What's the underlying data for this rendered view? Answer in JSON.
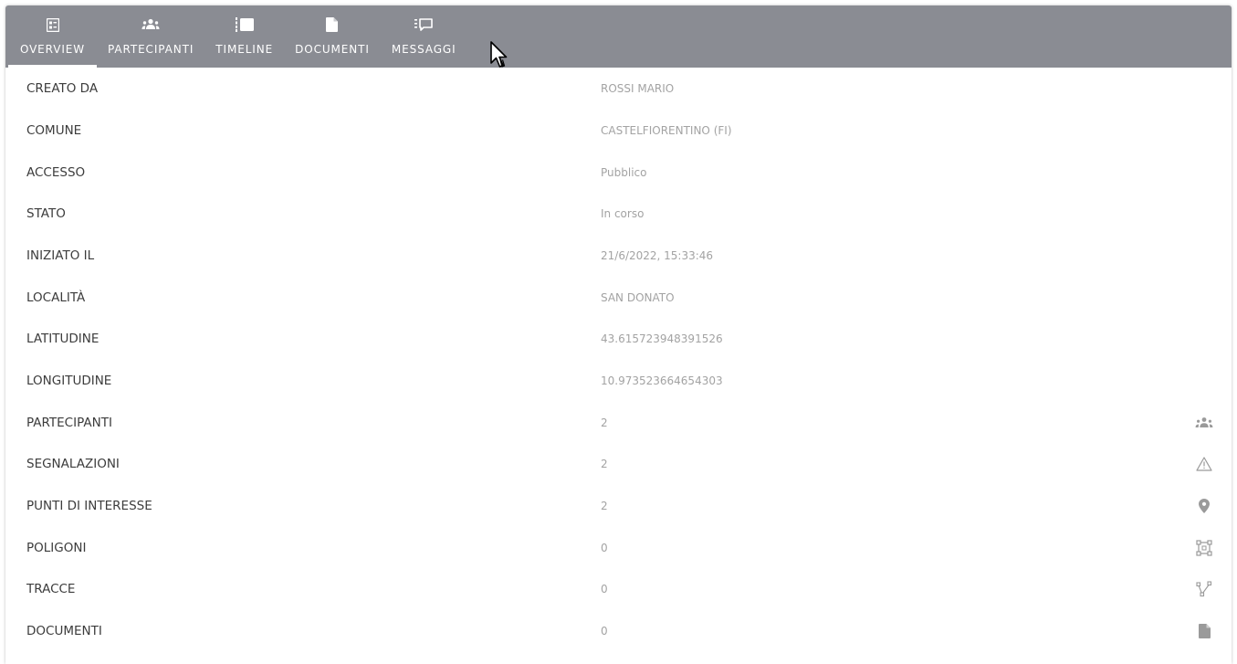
{
  "tabs": [
    {
      "label": "OVERVIEW",
      "icon": "overview-icon",
      "active": true
    },
    {
      "label": "PARTECIPANTI",
      "icon": "people-icon",
      "active": false
    },
    {
      "label": "TIMELINE",
      "icon": "timeline-icon",
      "active": false
    },
    {
      "label": "DOCUMENTI",
      "icon": "document-icon",
      "active": false
    },
    {
      "label": "MESSAGGI",
      "icon": "message-icon",
      "active": false
    }
  ],
  "rows": [
    {
      "label": "CREATO DA",
      "value": "ROSSI MARIO"
    },
    {
      "label": "COMUNE",
      "value": "CASTELFIORENTINO (FI)"
    },
    {
      "label": "ACCESSO",
      "value": "Pubblico"
    },
    {
      "label": "STATO",
      "value": "In corso"
    },
    {
      "label": "INIZIATO IL",
      "value": "21/6/2022, 15:33:46"
    },
    {
      "label": "LOCALITÀ",
      "value": "SAN DONATO"
    },
    {
      "label": "LATITUDINE",
      "value": "43.615723948391526"
    },
    {
      "label": "LONGITUDINE",
      "value": "10.973523664654303"
    },
    {
      "label": "PARTECIPANTI",
      "value": "2",
      "icon": "people-icon"
    },
    {
      "label": "SEGNALAZIONI",
      "value": "2",
      "icon": "warning-icon"
    },
    {
      "label": "PUNTI DI INTERESSE",
      "value": "2",
      "icon": "map-pin-icon"
    },
    {
      "label": "POLIGONI",
      "value": "0",
      "icon": "polygon-icon"
    },
    {
      "label": "TRACCE",
      "value": "0",
      "icon": "route-icon"
    },
    {
      "label": "DOCUMENTI",
      "value": "0",
      "icon": "document-icon"
    }
  ],
  "colors": {
    "tabbar_bg": "#8a8c93",
    "label_text": "#3c3c3c",
    "value_text": "#a3a3a3",
    "icon_gray": "#9a9a9a"
  }
}
